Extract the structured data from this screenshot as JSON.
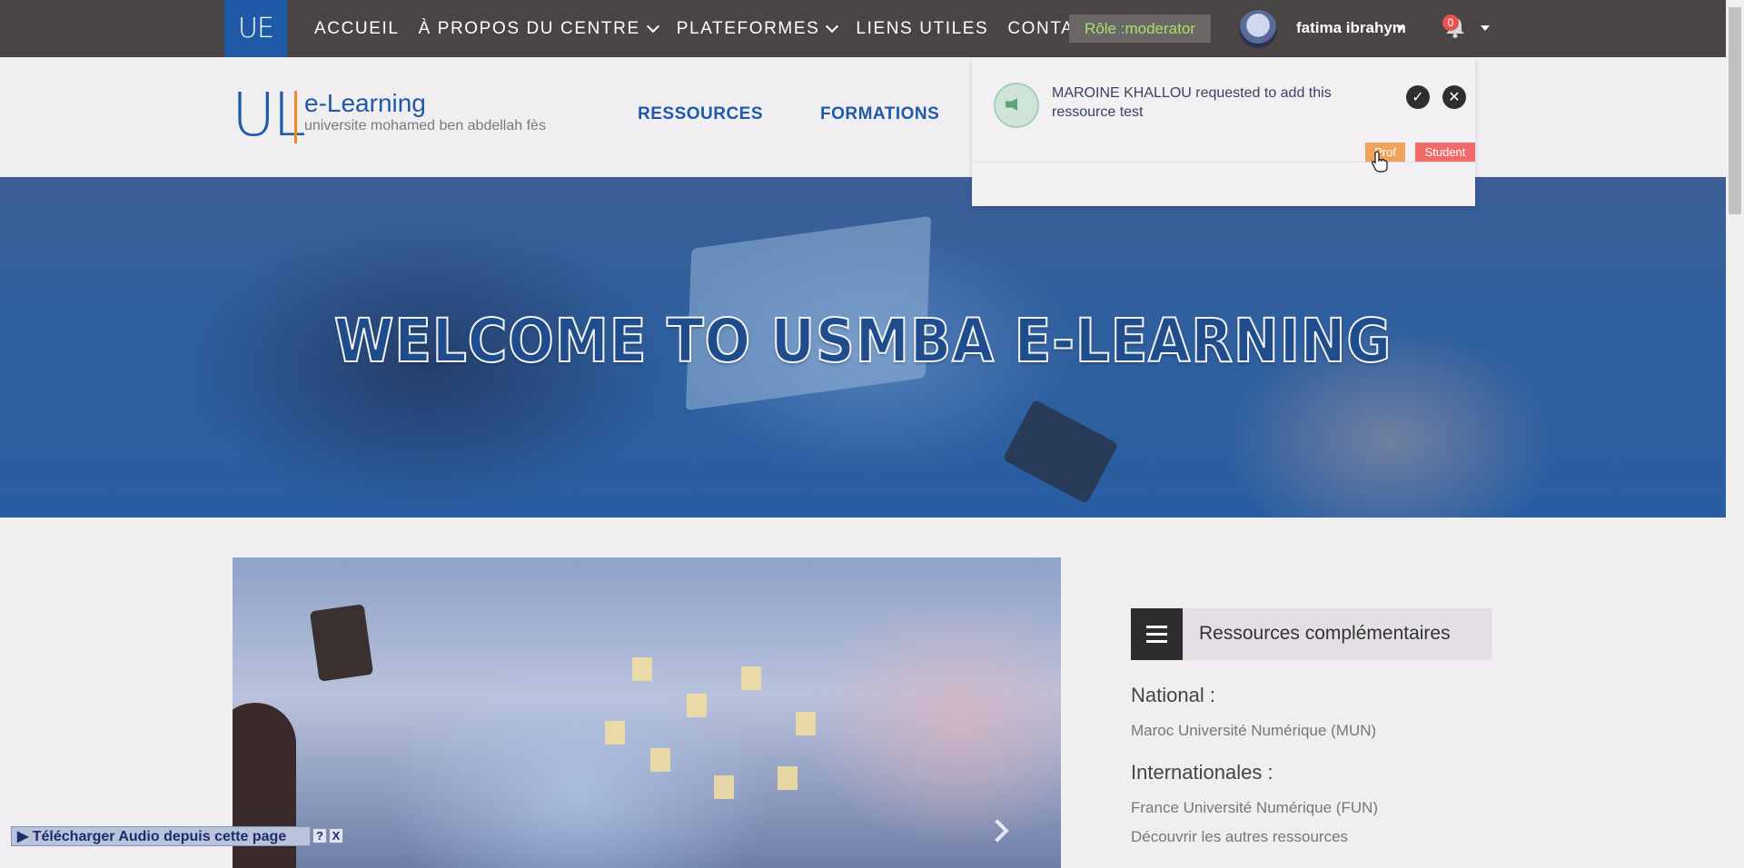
{
  "topbar": {
    "brand_short": "UE",
    "nav": [
      {
        "label": "ACCUEIL"
      },
      {
        "label": "À PROPOS DU CENTRE"
      },
      {
        "label": "PLATEFORMES"
      },
      {
        "label": "LIENS UTILES"
      },
      {
        "label": "CONTACT"
      }
    ],
    "role_badge": "Rôle :moderator",
    "user_name": "fatima ibrahym",
    "notification_count": "0"
  },
  "header": {
    "logo_mark": "UL",
    "logo_title": "e-Learning",
    "logo_subtitle": "universite mohamed ben abdellah fès",
    "nav": [
      {
        "label": "RESSOURCES"
      },
      {
        "label": "FORMATIONS"
      }
    ]
  },
  "hero": {
    "title": "WELCOME TO USMBA E-LEARNING"
  },
  "notification": {
    "message": "MAROINE KHALLOU requested to add this ressource test",
    "accept_icon": "✓",
    "reject_icon": "✕",
    "tags": [
      {
        "label": "Prof",
        "color": "#f0a35a"
      },
      {
        "label": "Student",
        "color": "#f26b6b"
      }
    ]
  },
  "sidebar": {
    "title": "Ressources complémentaires",
    "national_heading": "National :",
    "national_links": [
      "Maroc Université Numérique (MUN)"
    ],
    "international_heading": "Internationales :",
    "international_links": [
      "France Université Numérique (FUN)",
      "Découvrir les autres ressources"
    ]
  },
  "audio_bar": {
    "label": "▶ Télécharger Audio depuis cette page",
    "help": "?",
    "close": "X"
  },
  "colors": {
    "topbar": "#4a4545",
    "brand_blue": "#1e5aa8",
    "accent_orange": "#f08a24",
    "role_text": "#a8e06a"
  }
}
